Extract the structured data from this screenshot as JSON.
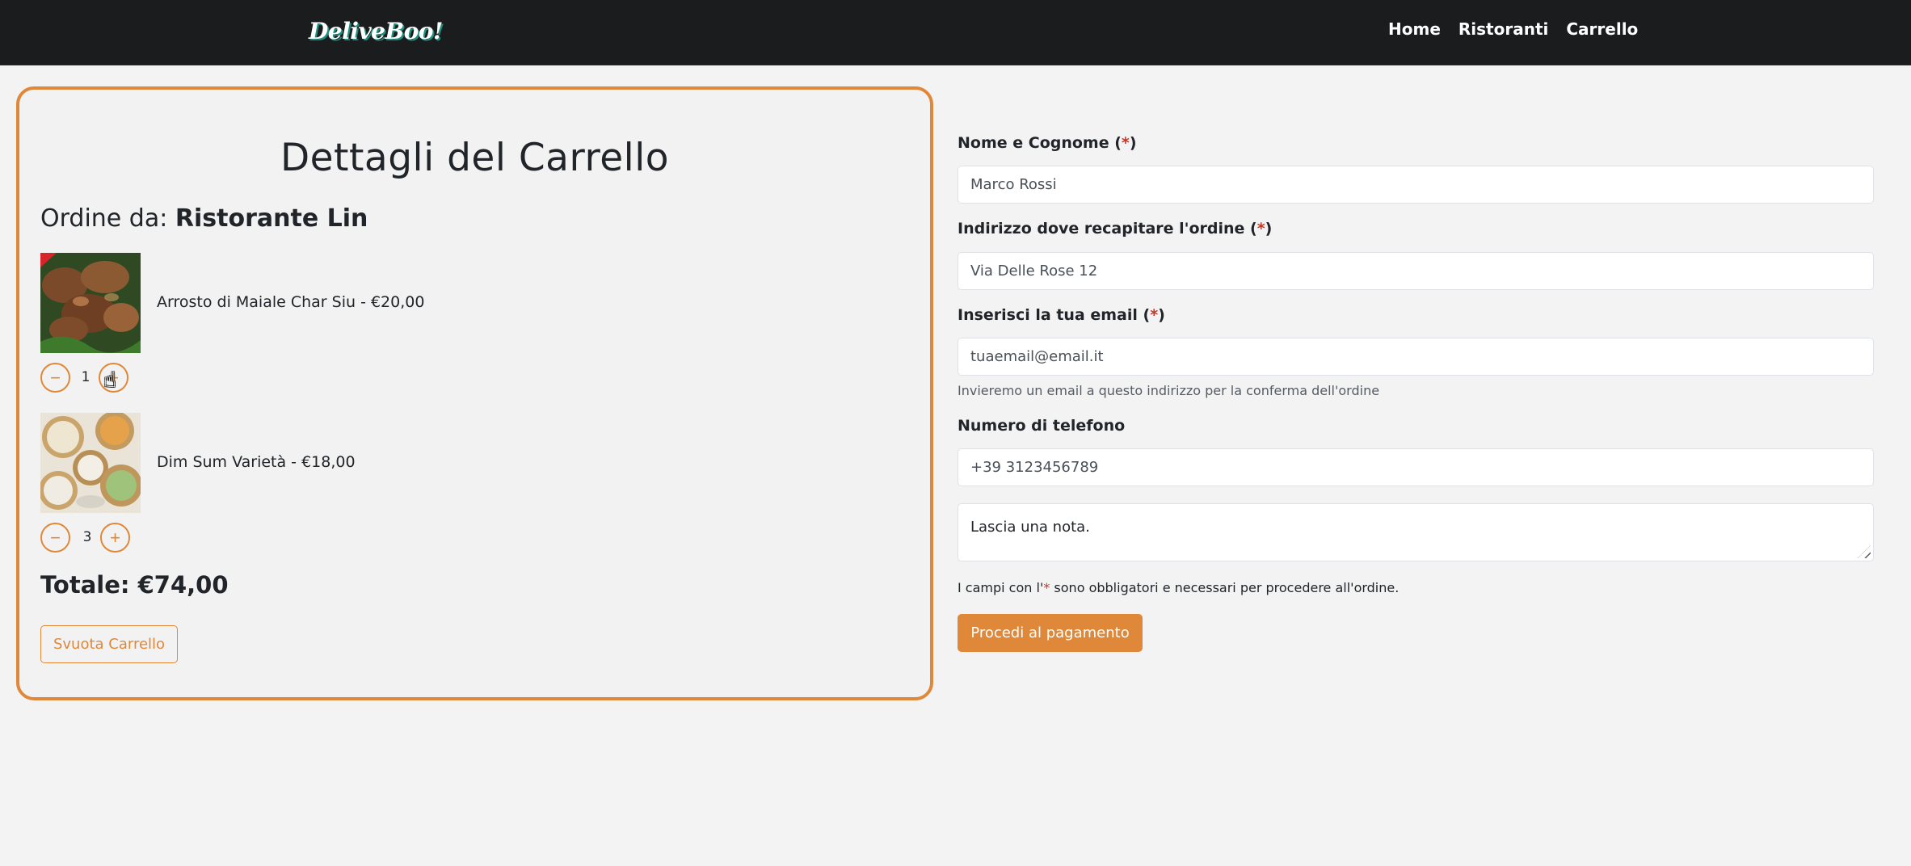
{
  "navbar": {
    "logo": "DeliveBoo!",
    "links": [
      "Home",
      "Ristoranti",
      "Carrello"
    ]
  },
  "cart": {
    "title": "Dettagli del Carrello",
    "order_from_label": "Ordine da:",
    "restaurant": "Ristorante Lin",
    "items": [
      {
        "name": "Arrosto di Maiale Char Siu - €20,00",
        "quantity": "1",
        "image": "char-siu-pork-photo"
      },
      {
        "name": "Dim Sum Varietà - €18,00",
        "quantity": "3",
        "image": "dim-sum-photo"
      }
    ],
    "total": "Totale: €74,00",
    "empty_button": "Svuota Carrello",
    "minus_symbol": "−",
    "plus_symbol": "+"
  },
  "form": {
    "name": {
      "label": "Nome e Cognome (",
      "req": "*",
      "close": ")",
      "value": "Marco Rossi"
    },
    "address": {
      "label": "Indirizzo dove recapitare l'ordine (",
      "req": "*",
      "close": ")",
      "value": "Via Delle Rose 12"
    },
    "email": {
      "label": "Inserisci la tua email (",
      "req": "*",
      "close": ")",
      "value": "tuaemail@email.it",
      "help": "Invieremo un email a questo indirizzo per la conferma dell'ordine"
    },
    "phone": {
      "label": "Numero di telefono",
      "value": "+39 3123456789"
    },
    "note": {
      "placeholder": "Lascia una nota."
    },
    "required_note_pre": "I campi con l'",
    "required_note_star": "*",
    "required_note_post": " sono obbligatori e necessari per procedere all'ordine.",
    "submit": "Procedi al pagamento"
  },
  "colors": {
    "accent": "#e0883a",
    "navbar": "#1b1c1e",
    "background": "#f3f3f3",
    "required": "#c0392b"
  }
}
